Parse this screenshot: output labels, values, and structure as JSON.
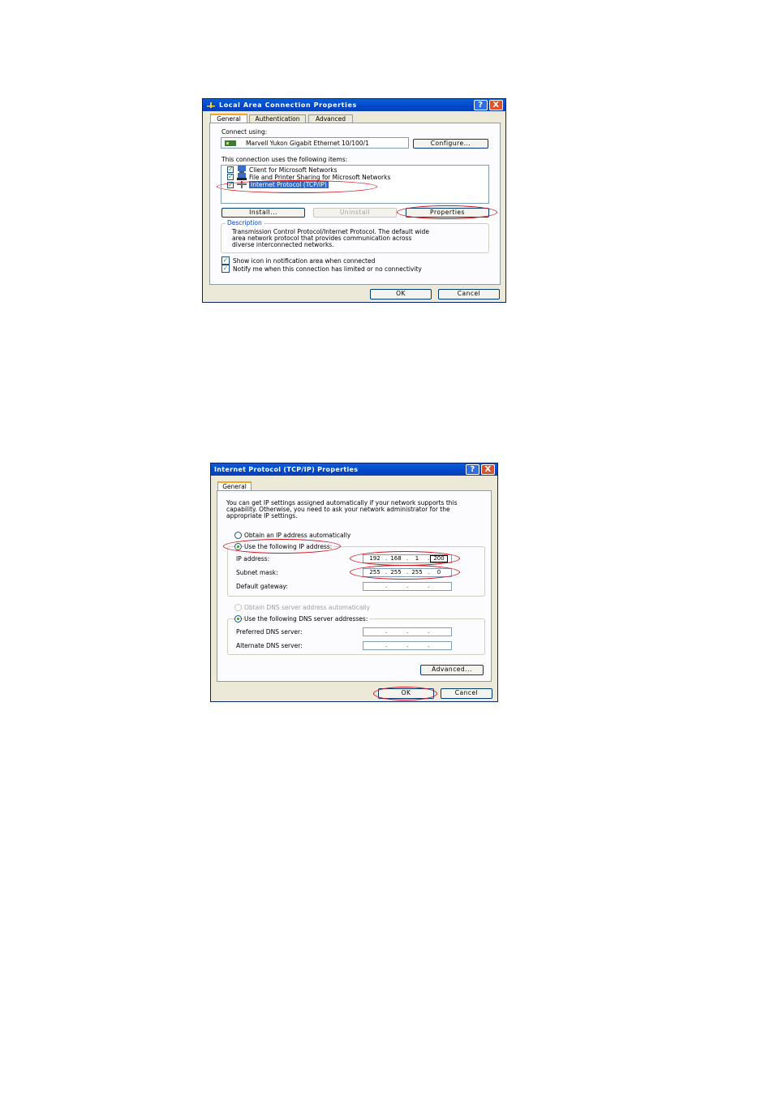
{
  "dialog1": {
    "title": "Local Area Connection Properties",
    "tabs": [
      "General",
      "Authentication",
      "Advanced"
    ],
    "connect_using_label": "Connect using:",
    "adapter_name": "Marvell Yukon Gigabit Ethernet 10/100/1",
    "configure_button": "Configure...",
    "items_label": "This connection uses the following items:",
    "items": [
      {
        "label": "Client for Microsoft Networks",
        "checked": true
      },
      {
        "label": "File and Printer Sharing for Microsoft Networks",
        "checked": true
      },
      {
        "label": "Internet Protocol (TCP/IP)",
        "checked": true,
        "selected": true
      }
    ],
    "install_button": "Install...",
    "uninstall_button": "Uninstall",
    "properties_button": "Properties",
    "description_title": "Description",
    "description_text_1": "Transmission Control Protocol/Internet Protocol. The default wide",
    "description_text_2": "area network protocol that provides communication across",
    "description_text_3": "diverse interconnected networks.",
    "show_icon_label": "Show icon in notification area when connected",
    "notify_label": "Notify me when this connection has limited or no connectivity",
    "ok_button": "OK",
    "cancel_button": "Cancel",
    "help_glyph": "?",
    "close_glyph": "X"
  },
  "dialog2": {
    "title": "Internet Protocol (TCP/IP) Properties",
    "tab": "General",
    "intro_1": "You can get IP settings assigned automatically if your network supports this",
    "intro_2": "capability. Otherwise, you need to ask your network administrator for the",
    "intro_3": "appropriate IP settings.",
    "obtain_ip_label": "Obtain an IP address automatically",
    "use_ip_label": "Use the following IP address:",
    "ip_address_label": "IP address:",
    "ip_address": [
      "192",
      "168",
      "1",
      "200"
    ],
    "subnet_mask_label": "Subnet mask:",
    "subnet_mask": [
      "255",
      "255",
      "255",
      "0"
    ],
    "gateway_label": "Default gateway:",
    "obtain_dns_label": "Obtain DNS server address automatically",
    "use_dns_label": "Use the following DNS server addresses:",
    "preferred_dns_label": "Preferred DNS server:",
    "alternate_dns_label": "Alternate DNS server:",
    "advanced_button": "Advanced...",
    "ok_button": "OK",
    "cancel_button": "Cancel",
    "help_glyph": "?",
    "close_glyph": "X"
  },
  "colors": {
    "title_blue": "#0047c7",
    "dialog_bg": "#ece9d8",
    "highlight_oval": "#d4141c",
    "selection": "#316ac5"
  }
}
